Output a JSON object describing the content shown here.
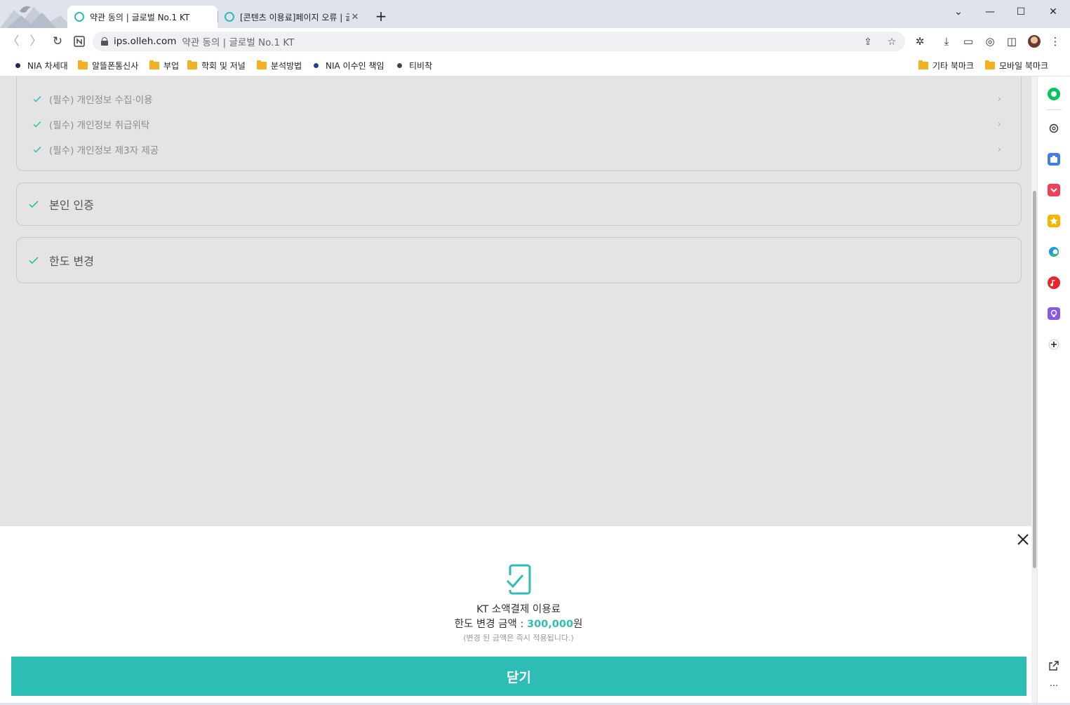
{
  "browser": {
    "tabs": [
      {
        "title": "약관 동의 | 글로벌 No.1 KT",
        "active": true
      },
      {
        "title": "[콘텐츠 이용료]페이지 오류 | 글로벌 No.1 KT",
        "active": false
      }
    ],
    "address": {
      "host": "ips.olleh.com",
      "page_title": "약관 동의 | 글로벌 No.1 KT"
    },
    "bookmarks": [
      {
        "label": "NIA 차세대",
        "type": "dot",
        "color": "#1f2a56"
      },
      {
        "label": "알뜰폰통신사",
        "type": "folder"
      },
      {
        "label": "부업",
        "type": "folder"
      },
      {
        "label": "학회 및 저널",
        "type": "folder"
      },
      {
        "label": "분석방법",
        "type": "folder"
      },
      {
        "label": "NIA 이수인 책임",
        "type": "dot",
        "color": "#2b3c8e"
      },
      {
        "label": "티비착",
        "type": "dot",
        "color": "#444444"
      }
    ],
    "bookmarks_right": [
      {
        "label": "기타 북마크"
      },
      {
        "label": "모바일 북마크"
      }
    ]
  },
  "terms": {
    "items": [
      {
        "label": "(필수) 개인정보 수집·이용"
      },
      {
        "label": "(필수) 개인정보 취급위탁"
      },
      {
        "label": "(필수) 개인정보 제3자 제공"
      }
    ]
  },
  "sections": {
    "identity": {
      "label": "본인 인증"
    },
    "limit": {
      "label": "한도 변경"
    }
  },
  "sheet": {
    "title": "KT 소액결제 이용료",
    "amount_prefix": "한도 변경 금액 : ",
    "amount_value": "300,000",
    "amount_unit": "원",
    "note": "(변경 된 금액은 즉시 적용됩니다.)",
    "close_button": "닫기"
  },
  "colors": {
    "accent": "#2ebdb5"
  }
}
